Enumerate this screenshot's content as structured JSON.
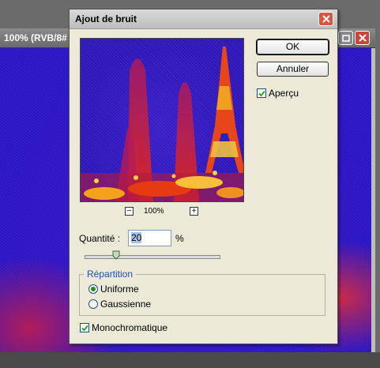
{
  "document": {
    "title": "100% (RVB/8#"
  },
  "dialog": {
    "title": "Ajout de bruit",
    "ok_label": "OK",
    "cancel_label": "Annuler",
    "preview_label": "Aperçu",
    "preview_checked": true,
    "zoom": {
      "minus": "−",
      "value": "100%",
      "plus": "+"
    },
    "quantity": {
      "label": "Quantité :",
      "value": "20",
      "unit": "%"
    },
    "distribution": {
      "legend": "Répartition",
      "options": [
        {
          "label": "Uniforme",
          "checked": true
        },
        {
          "label": "Gaussienne",
          "checked": false
        }
      ]
    },
    "monochrome": {
      "label": "Monochromatique",
      "checked": true
    }
  },
  "colors": {
    "canvas": "#2b14c4",
    "accent_legend": "#1d4fb3",
    "close_button": "#d8553f"
  }
}
